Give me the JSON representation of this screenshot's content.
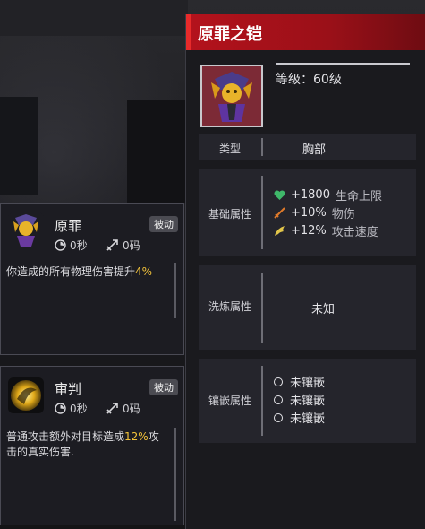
{
  "item": {
    "title": "原罪之铠",
    "level_label": "等级：60级",
    "type_label": "类型",
    "type_value": "胸部",
    "base_label": "基础属性",
    "base_attrs": [
      {
        "value": "+1800",
        "name": "生命上限",
        "icon": "heart-icon",
        "color": "#3fb86a"
      },
      {
        "value": "+10%",
        "name": "物伤",
        "icon": "sword-icon",
        "color": "#e07a2a"
      },
      {
        "value": "+12%",
        "name": "攻击速度",
        "icon": "wing-icon",
        "color": "#e2c64a"
      }
    ],
    "refine_label": "洗炼属性",
    "refine_value": "未知",
    "socket_label": "镶嵌属性",
    "sockets": [
      "未镶嵌",
      "未镶嵌",
      "未镶嵌"
    ]
  },
  "skills": [
    {
      "name": "原罪",
      "badge": "被动",
      "cooldown": "0秒",
      "range": "0码",
      "desc_pre": "你造成的所有物理伤害提升",
      "desc_hl": "4%",
      "desc_post": ""
    },
    {
      "name": "审判",
      "badge": "被动",
      "cooldown": "0秒",
      "range": "0码",
      "desc_pre": "普通攻击额外对目标造成",
      "desc_hl": "12%",
      "desc_post": "攻击的真实伤害."
    }
  ],
  "colors": {
    "title_bar": "#b4121c",
    "highlight": "#f2c23a"
  }
}
